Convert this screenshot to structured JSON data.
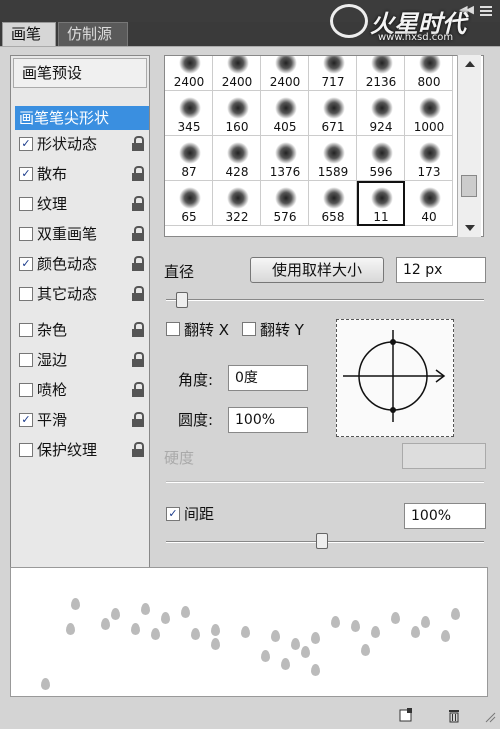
{
  "tabs": {
    "brush": "画笔",
    "clone_source": "仿制源"
  },
  "watermark": {
    "logo_text": "火星时代",
    "url": "www.hxsd.com"
  },
  "left_panel": {
    "preset_label": "画笔预设",
    "items": [
      {
        "label": "画笔笔尖形状",
        "checked": null,
        "selected": true,
        "lock": false
      },
      {
        "label": "形状动态",
        "checked": true,
        "selected": false,
        "lock": true
      },
      {
        "label": "散布",
        "checked": true,
        "selected": false,
        "lock": true
      },
      {
        "label": "纹理",
        "checked": false,
        "selected": false,
        "lock": true
      },
      {
        "label": "双重画笔",
        "checked": false,
        "selected": false,
        "lock": true
      },
      {
        "label": "颜色动态",
        "checked": true,
        "selected": false,
        "lock": true
      },
      {
        "label": "其它动态",
        "checked": false,
        "selected": false,
        "lock": true
      },
      {
        "label": "杂色",
        "checked": false,
        "selected": false,
        "lock": true
      },
      {
        "label": "湿边",
        "checked": false,
        "selected": false,
        "lock": true
      },
      {
        "label": "喷枪",
        "checked": false,
        "selected": false,
        "lock": true
      },
      {
        "label": "平滑",
        "checked": true,
        "selected": false,
        "lock": true
      },
      {
        "label": "保护纹理",
        "checked": false,
        "selected": false,
        "lock": true
      }
    ]
  },
  "brush_grid": {
    "sizes": [
      "2400",
      "2400",
      "2400",
      "717",
      "2136",
      "800",
      "345",
      "160",
      "405",
      "671",
      "924",
      "1000",
      "87",
      "428",
      "1376",
      "1589",
      "596",
      "173",
      "65",
      "322",
      "576",
      "658",
      "11",
      "40"
    ],
    "selected_index": 22
  },
  "tip_shape": {
    "diameter_label": "直径",
    "use_sample_size_button": "使用取样大小",
    "diameter_value": "12 px",
    "flip_x_label": "翻转 X",
    "flip_y_label": "翻转 Y",
    "angle_label": "角度:",
    "angle_value": "0度",
    "roundness_label": "圆度:",
    "roundness_value": "100%",
    "hardness_label": "硬度",
    "spacing_label": "间距",
    "spacing_checked": true,
    "spacing_value": "100%"
  },
  "footer": {
    "new_icon": "new-preset-icon",
    "delete_icon": "trash-icon"
  }
}
